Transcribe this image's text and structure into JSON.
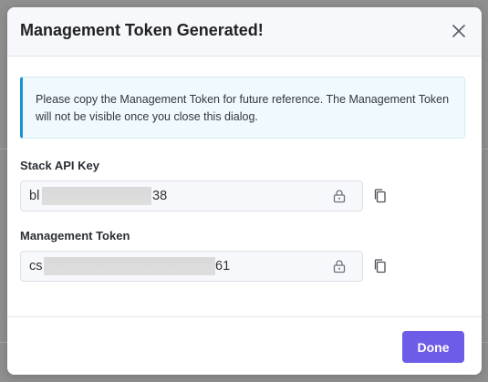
{
  "dialog": {
    "title": "Management Token Generated!",
    "notice": "Please copy the Management Token for future reference. The Management Token will not be visible once you close this dialog."
  },
  "fields": {
    "stack_api_key": {
      "label": "Stack API Key",
      "prefix": "bl",
      "suffix": "38",
      "icon": "lock-icon"
    },
    "management_token": {
      "label": "Management Token",
      "prefix": "cs",
      "suffix": "61",
      "icon": "lock-icon"
    }
  },
  "footer": {
    "done_label": "Done"
  },
  "colors": {
    "accent": "#6c5ce7",
    "info_border": "#1a8fd1",
    "info_bg": "#f0f9fd"
  }
}
